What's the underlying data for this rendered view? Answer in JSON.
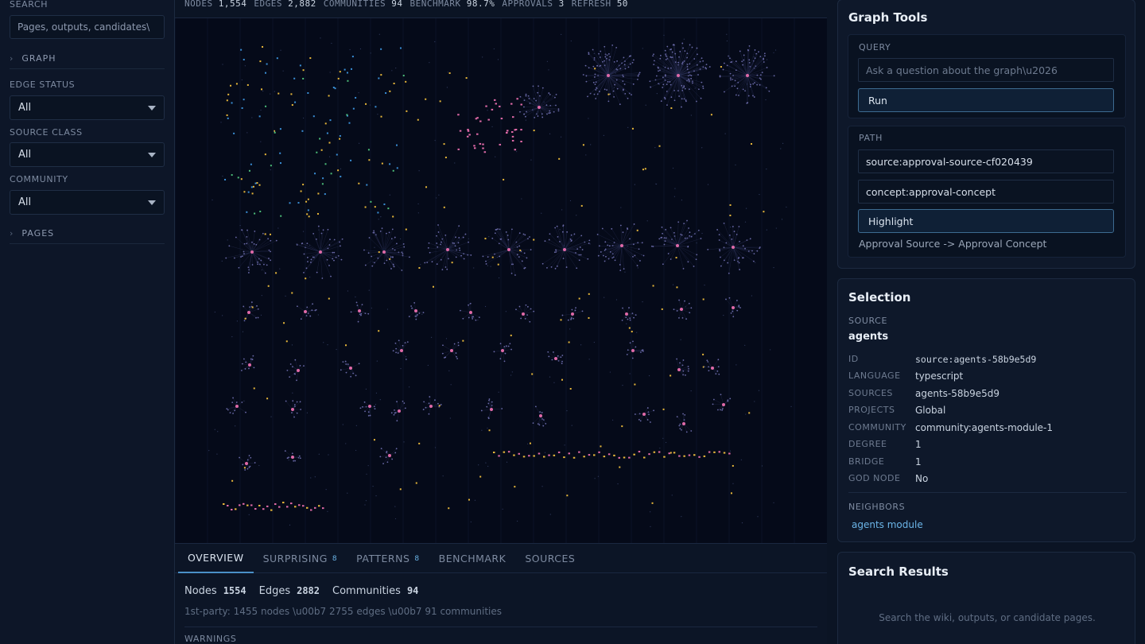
{
  "sidebar": {
    "search_label": "SEARCH",
    "search_placeholder": "Pages, outputs, candidates\\",
    "graph_section": "GRAPH",
    "section_marker": "›",
    "edge_status": {
      "label": "EDGE STATUS",
      "value": "All"
    },
    "source_class": {
      "label": "SOURCE CLASS",
      "value": "All"
    },
    "community": {
      "label": "COMMUNITY",
      "value": "All"
    },
    "pages_section": "PAGES"
  },
  "stats": [
    {
      "label": "NODES",
      "value": "1,554"
    },
    {
      "label": "EDGES",
      "value": "2,882"
    },
    {
      "label": "COMMUNITIES",
      "value": "94"
    },
    {
      "label": "BENCHMARK",
      "value": "98.7%"
    },
    {
      "label": "APPROVALS",
      "value": "3"
    },
    {
      "label": "REFRESH",
      "value": "50"
    }
  ],
  "tabs": [
    {
      "label": "OVERVIEW",
      "badge": "",
      "active": true
    },
    {
      "label": "SURPRISING",
      "badge": "8"
    },
    {
      "label": "PATTERNS",
      "badge": "8"
    },
    {
      "label": "BENCHMARK",
      "badge": ""
    },
    {
      "label": "SOURCES",
      "badge": ""
    }
  ],
  "overview": {
    "nodes_label": "Nodes",
    "nodes": "1554",
    "edges_label": "Edges",
    "edges": "2882",
    "communities_label": "Communities",
    "communities": "94",
    "first_party": "1st-party: 1455 nodes \\u00b7 2755 edges \\u00b7 91 communities",
    "warnings_label": "WARNINGS"
  },
  "graph_tools": {
    "title": "Graph Tools",
    "query_label": "QUERY",
    "query_placeholder": "Ask a question about the graph\\u2026",
    "run_label": "Run",
    "path_label": "PATH",
    "path_source": "source:approval-source-cf020439",
    "path_target": "concept:approval-concept",
    "highlight_label": "Highlight",
    "path_result": "Approval Source -> Approval Concept"
  },
  "selection": {
    "title": "Selection",
    "kind": "SOURCE",
    "name": "agents",
    "fields": [
      {
        "key": "ID",
        "value": "source:agents-58b9e5d9"
      },
      {
        "key": "LANGUAGE",
        "value": "typescript"
      },
      {
        "key": "SOURCES",
        "value": "agents-58b9e5d9"
      },
      {
        "key": "PROJECTS",
        "value": "Global"
      },
      {
        "key": "COMMUNITY",
        "value": "community:agents-module-1"
      },
      {
        "key": "DEGREE",
        "value": "1"
      },
      {
        "key": "BRIDGE",
        "value": "1"
      },
      {
        "key": "GOD NODE",
        "value": "No"
      }
    ],
    "neighbors_label": "NEIGHBORS",
    "neighbor": "agents module"
  },
  "search_results": {
    "title": "Search Results",
    "empty": "Search the wiki, outputs, or candidate pages."
  },
  "colors": {
    "accent": "#4a90c8",
    "node_pink": "#e06aa8",
    "node_yellow": "#e8b83a",
    "node_blue": "#3a8fd6",
    "node_green": "#4dbf7a",
    "node_purple": "#8a7fd0"
  }
}
